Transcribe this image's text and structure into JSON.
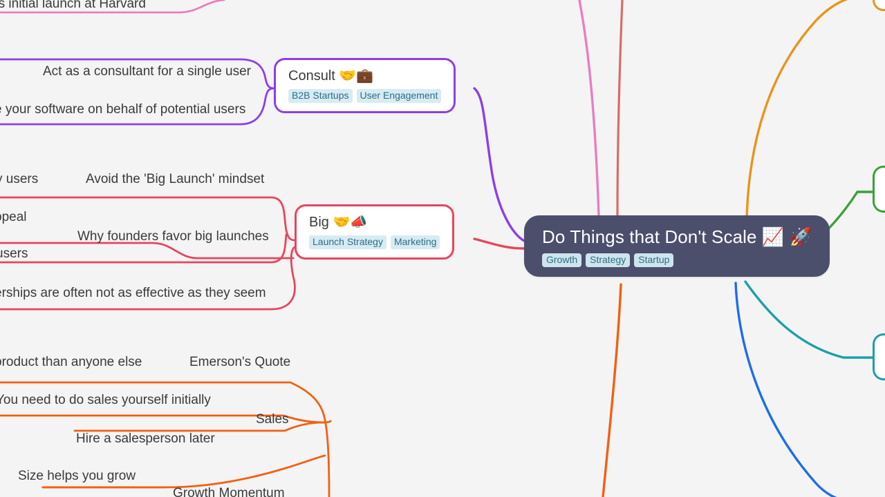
{
  "app": {
    "type": "mindmap",
    "background_color": "#f4f4f4"
  },
  "root": {
    "title": "Do Things that Don't Scale 📈 🚀",
    "tags": [
      "Growth",
      "Strategy",
      "Startup"
    ],
    "background_color": "#4b4f6b",
    "text_color": "#ffffff"
  },
  "branch_nodes": [
    {
      "id": "consult",
      "title": "Consult 🤝💼",
      "tags": [
        "B2B Startups",
        "User Engagement"
      ],
      "color": "#8b3fe8"
    },
    {
      "id": "big",
      "title": "Big 🤝📣",
      "tags": [
        "Launch Strategy",
        "Marketing"
      ],
      "color": "#e8445c"
    }
  ],
  "label_nodes": [
    {
      "id": "harvard-launch",
      "text": "'s initial launch at Harvard",
      "color": "#e87ec0",
      "clipped": "left"
    },
    {
      "id": "act-as-consultant",
      "text": "Act as a consultant for a single user",
      "color": "#8b3fe8",
      "clipped": "none"
    },
    {
      "id": "use-software-behalf",
      "text": "e your software on behalf of potential users",
      "color": "#8b3fe8",
      "clipped": "left"
    },
    {
      "id": "by-users",
      "text": "y users",
      "color": "#e8445c",
      "clipped": "left"
    },
    {
      "id": "avoid-big-launch",
      "text": "Avoid the 'Big Launch' mindset",
      "color": "#e8445c",
      "clipped": "none"
    },
    {
      "id": "appeal",
      "text": "ppeal",
      "color": "#e8445c",
      "clipped": "left"
    },
    {
      "id": "why-founders-favor",
      "text": "Why founders favor big launches",
      "color": "#e8445c",
      "clipped": "none"
    },
    {
      "id": "users",
      "text": "users",
      "color": "#e8445c",
      "clipped": "left"
    },
    {
      "id": "partnerships",
      "text": "erships are often not as effective as they seem",
      "color": "#e8445c",
      "clipped": "left"
    },
    {
      "id": "product-than-anyone",
      "text": "product than anyone else",
      "color": "#f06e16",
      "clipped": "left"
    },
    {
      "id": "emersons-quote",
      "text": "Emerson's Quote",
      "color": "#f06e16",
      "clipped": "none"
    },
    {
      "id": "sales-yourself",
      "text": "You need to do sales yourself initially",
      "color": "#f06e16",
      "clipped": "left"
    },
    {
      "id": "sales",
      "text": "Sales",
      "color": "#f06e16",
      "clipped": "none"
    },
    {
      "id": "hire-salesperson",
      "text": "Hire a salesperson later",
      "color": "#f06e16",
      "clipped": "none"
    },
    {
      "id": "size-helps-grow",
      "text": "Size helps you grow",
      "color": "#f06e16",
      "clipped": "none"
    },
    {
      "id": "growth-momentum",
      "text": "Growth Momentum",
      "color": "#f06e16",
      "clipped": "bottom"
    }
  ],
  "edge_colors": {
    "pink": "#e87ec0",
    "salmon": "#d96b68",
    "purple": "#8b3fe8",
    "crimson": "#e8445c",
    "orange_dark": "#e8941a",
    "orange": "#f45f10",
    "green": "#3aa13a",
    "teal": "#1ba0ab",
    "blue": "#1c6ee8"
  }
}
